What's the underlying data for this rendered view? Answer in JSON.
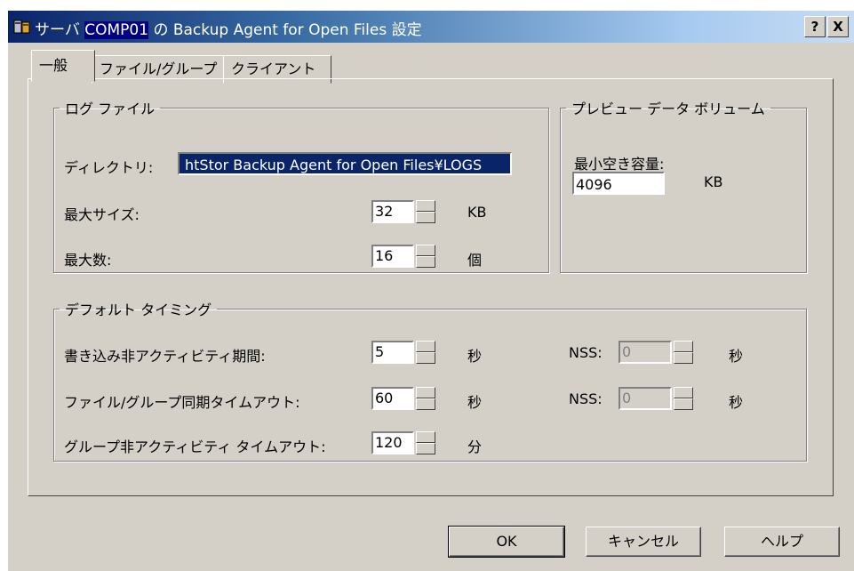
{
  "window": {
    "title_prefix": "サーバ ",
    "server": "COMP01",
    "title_suffix": " の Backup Agent for Open Files 設定",
    "help_button": "?",
    "close_button": "X"
  },
  "tabs": [
    {
      "label": "一般"
    },
    {
      "label": "ファイル/グループ"
    },
    {
      "label": "クライアント"
    }
  ],
  "log_file": {
    "legend": "ログ ファイル",
    "directory_label": "ディレクトリ:",
    "directory_value": "htStor Backup Agent for Open Files¥LOGS",
    "max_size_label": "最大サイズ:",
    "max_size_value": "32",
    "max_size_unit": "KB",
    "max_count_label": "最大数:",
    "max_count_value": "16",
    "max_count_unit": "個"
  },
  "preview": {
    "legend": "プレビュー データ ボリューム",
    "min_free_label": "最小空き容量:",
    "min_free_value": "4096",
    "min_free_unit": "KB"
  },
  "timing": {
    "legend": "デフォルト タイミング",
    "write_inactivity_label": "書き込み非アクティビティ期間:",
    "write_inactivity_value": "5",
    "write_inactivity_unit": "秒",
    "write_nss_label": "NSS:",
    "write_nss_value": "0",
    "write_nss_unit": "秒",
    "sync_timeout_label": "ファイル/グループ同期タイムアウト:",
    "sync_timeout_value": "60",
    "sync_timeout_unit": "秒",
    "sync_nss_label": "NSS:",
    "sync_nss_value": "0",
    "sync_nss_unit": "秒",
    "group_timeout_label": "グループ非アクティビティ タイムアウト:",
    "group_timeout_value": "120",
    "group_timeout_unit": "分"
  },
  "buttons": {
    "ok": "OK",
    "cancel": "キャンセル",
    "help": "ヘルプ"
  }
}
